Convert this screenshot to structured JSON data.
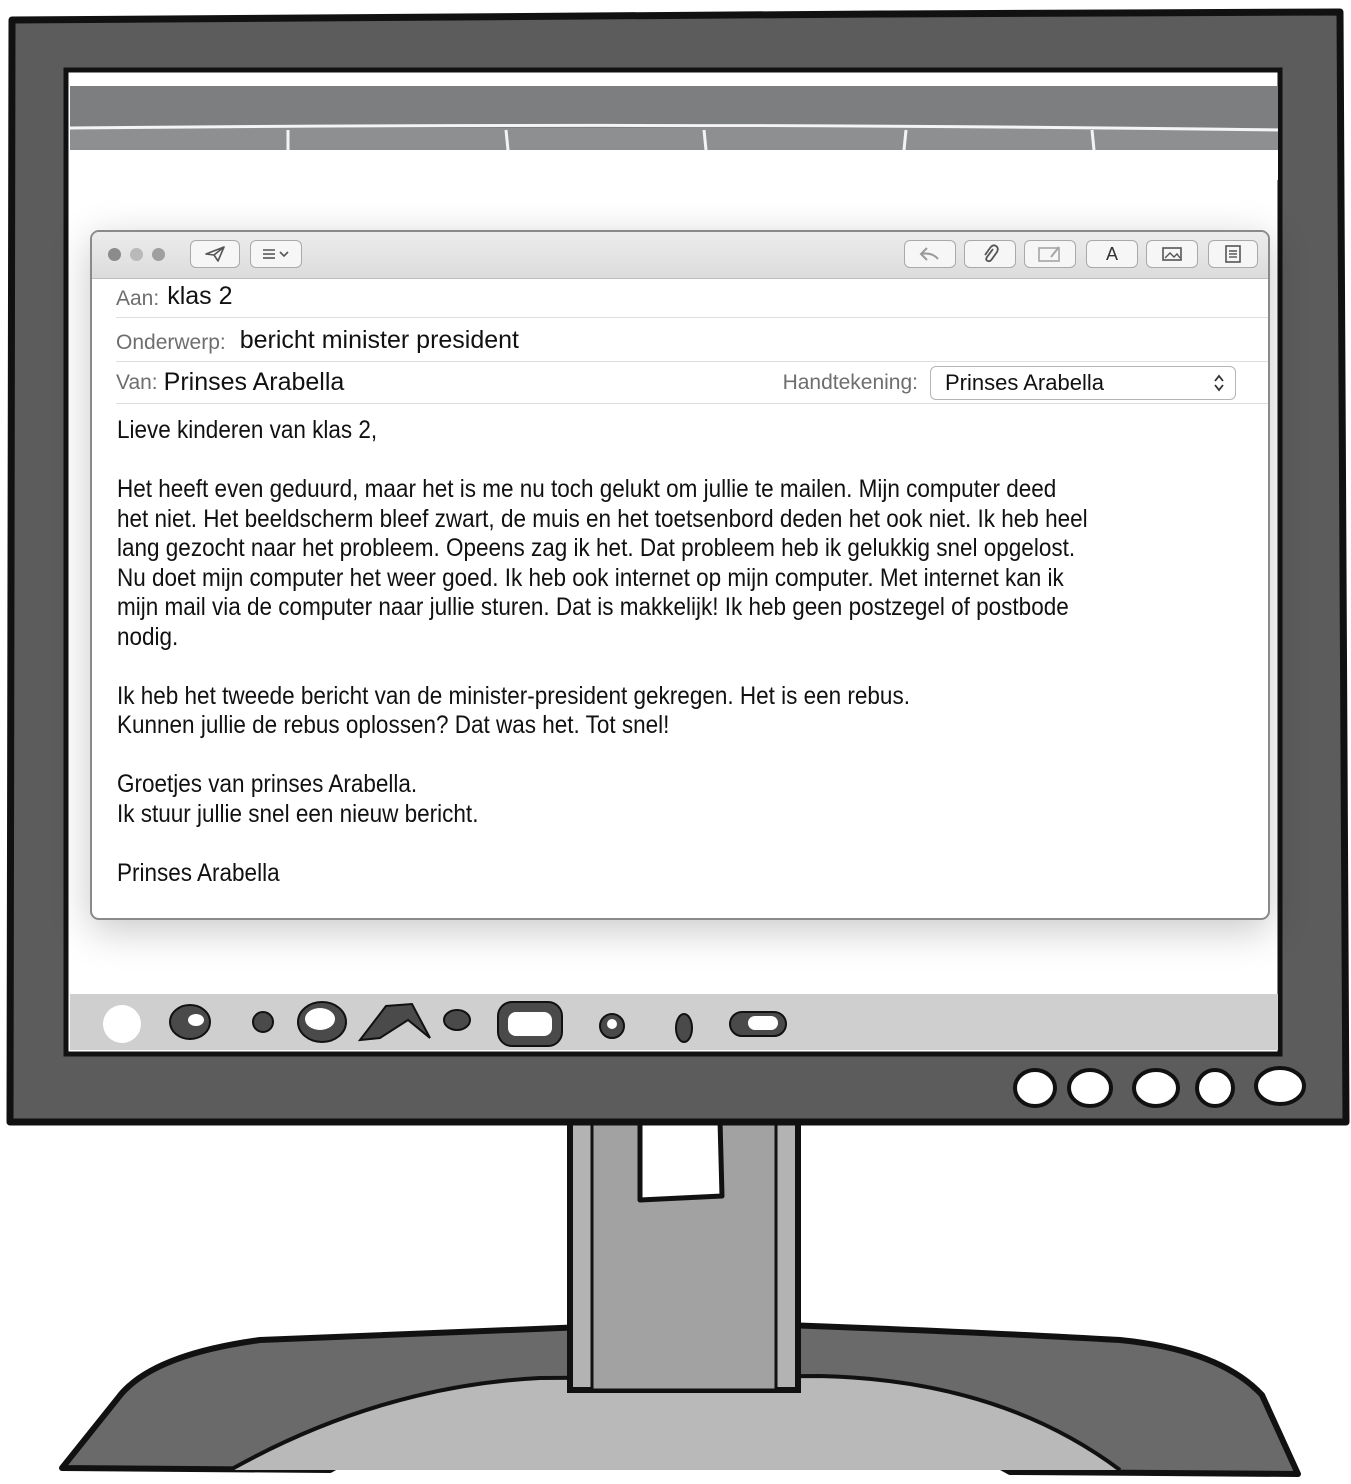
{
  "mail": {
    "toolbar": {
      "left_buttons": [
        "send-icon",
        "header-list-icon"
      ],
      "right_buttons": [
        "reply-icon",
        "attachment-icon",
        "annotation-icon",
        "font-icon",
        "photo-browser-icon",
        "format-icon"
      ],
      "font_glyph": "A"
    },
    "to": {
      "label": "Aan:",
      "value": "klas 2"
    },
    "subject": {
      "label": "Onderwerp:",
      "value": "bericht minister president"
    },
    "from": {
      "label": "Van:",
      "value": "Prinses Arabella"
    },
    "signature": {
      "label": "Handtekening:",
      "value": "Prinses Arabella"
    },
    "body": {
      "greeting": "Lieve kinderen van klas 2,",
      "paragraph1": [
        "Het heeft even geduurd, maar het is me nu toch gelukt om jullie te mailen. Mijn computer deed",
        "het niet. Het beeldscherm bleef zwart, de muis en het toetsenbord deden het ook niet. Ik heb heel",
        "lang gezocht naar het probleem. Opeens zag ik het. Dat probleem heb ik gelukkig snel opgelost.",
        "Nu doet mijn computer het weer goed. Ik heb ook internet op mijn computer. Met internet kan ik",
        "mijn mail via de computer naar jullie sturen. Dat is makkelijk! Ik heb geen postzegel of postbode",
        "nodig."
      ],
      "paragraph2": [
        "Ik heb het tweede bericht van de minister-president gekregen. Het is een rebus.",
        "Kunnen jullie de rebus oplossen? Dat was het. Tot snel!"
      ],
      "paragraph3": [
        "Groetjes van prinses Arabella.",
        "Ik stuur jullie snel een nieuw bericht."
      ],
      "closing": "Prinses Arabella"
    }
  },
  "colors": {
    "monitor_frame": "#5a5a5a",
    "outline": "#1a1a1a",
    "top_bar": "#7d7e80",
    "dock": "#cfcfcf"
  }
}
